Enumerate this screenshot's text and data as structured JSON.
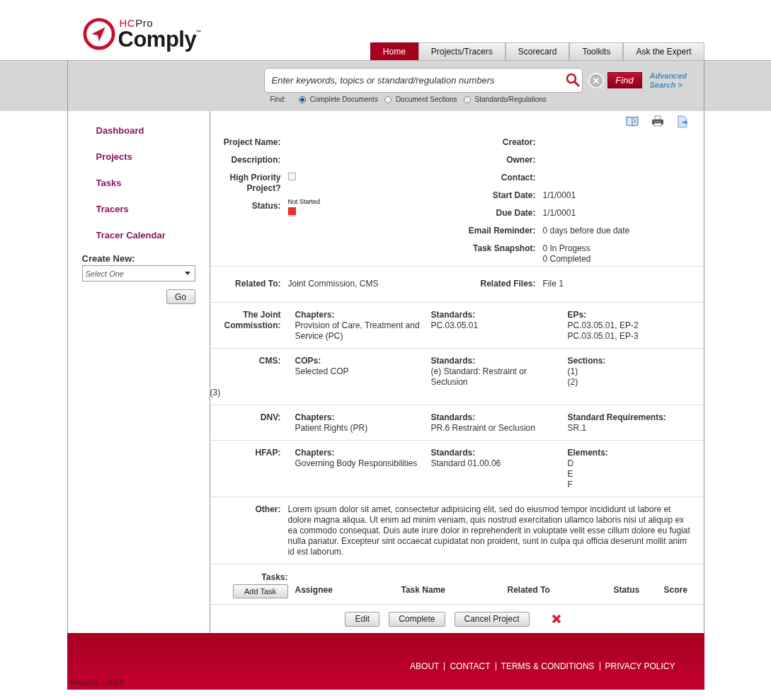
{
  "logo": {
    "prefix": "HC",
    "suffix": "Pro",
    "name": "Comply$^{™}$"
  },
  "nav_tabs": [
    {
      "label": "Home",
      "selected": true
    },
    {
      "label": "Projects/Tracers",
      "selected": false
    },
    {
      "label": "Scorecard",
      "selected": false
    },
    {
      "label": "Toolkits",
      "selected": false
    },
    {
      "label": "Ask the Expert",
      "selected": false
    }
  ],
  "search": {
    "placeholder": "Enter keywords, topics or standard/regulation numbers",
    "find_button": "Find",
    "advanced_link": "Advanced Search >",
    "find_label": "Find:",
    "options": [
      {
        "label": "Complete Documents",
        "selected": true
      },
      {
        "label": "Document Sections",
        "selected": false
      },
      {
        "label": "Standards/Regulations",
        "selected": false
      }
    ]
  },
  "sidebar": {
    "items": [
      {
        "label": "Dashboard"
      },
      {
        "label": "Projects"
      },
      {
        "label": "Tasks"
      },
      {
        "label": "Tracers"
      },
      {
        "label": "Tracer Calendar"
      }
    ],
    "create_new": "Create New:",
    "select_placeholder": "Select One",
    "go_button": "Go"
  },
  "project": {
    "left_fields": [
      {
        "kind": "text",
        "label": "Project Name:"
      },
      {
        "kind": "text",
        "label": "Description:"
      },
      {
        "kind": "checkbox",
        "label": "High Priority Project?",
        "checked": false
      },
      {
        "kind": "status",
        "label": "Status:",
        "value": "Not Started",
        "color": "#e8302a"
      }
    ],
    "right_fields": [
      {
        "label": "Creator:"
      },
      {
        "label": "Owner:"
      },
      {
        "label": "Contact:"
      },
      {
        "label": "Start Date:",
        "lines": [
          "1/1/0001"
        ]
      },
      {
        "label": "Due Date:",
        "lines": [
          "1/1/0001"
        ]
      },
      {
        "label": "Email Reminder:",
        "lines": [
          "0 days before due date"
        ]
      },
      {
        "label": "Task Snapshot:",
        "lines": [
          "0 In Progess",
          "0 Completed"
        ]
      }
    ]
  },
  "related": [
    {
      "label": "Related To:",
      "value": "Joint Commission, CMS"
    },
    {
      "label": "Related Files:",
      "value": "File 1"
    }
  ],
  "standards": [
    {
      "label": "The Joint Commisstion:",
      "columns": [
        {
          "heading": "Chapters:",
          "lines": [
            "Provision of Care, Treatment and Service (PC)"
          ]
        },
        {
          "heading": "Standards:",
          "lines": [
            "PC.03.05.01"
          ]
        },
        {
          "heading": "EPs:",
          "lines": [
            "PC.03.05.01, EP-2",
            "PC.03.05.01, EP-3"
          ]
        }
      ]
    },
    {
      "label": "CMS:",
      "columns": [
        {
          "heading": "COPs:",
          "lines": [
            "Selected COP"
          ]
        },
        {
          "heading": "Standards:",
          "lines": [
            "(e) Standard: Restraint or Seclusion"
          ]
        },
        {
          "heading": "Sections:",
          "lines": [
            "(1)",
            "(2)"
          ]
        }
      ],
      "stray_text": "(3)"
    },
    {
      "label": "DNV:",
      "columns": [
        {
          "heading": "Chapters:",
          "lines": [
            "Patient Rights (PR)"
          ]
        },
        {
          "heading": "Standards:",
          "lines": [
            "PR.6 Restraint or Seclusion"
          ]
        },
        {
          "heading": "Standard Requirements:",
          "lines": [
            "SR.1"
          ]
        }
      ]
    },
    {
      "label": "HFAP:",
      "columns": [
        {
          "heading": "Chapters:",
          "lines": [
            "Governing Body Responsibilities"
          ]
        },
        {
          "heading": "Standards:",
          "lines": [
            "Standard 01.00.06"
          ]
        },
        {
          "heading": "Elements:",
          "lines": [
            "D",
            "E",
            "F"
          ]
        }
      ]
    }
  ],
  "other": {
    "label": "Other:",
    "text": "Lorem ipsum dolor sit amet, consectetur adipisicing elit, sed do eiusmod tempor incididunt ut labore et dolore magna aliqua. Ut enim ad minim veniam, quis nostrud exercitation ullamco laboris nisi ut aliquip ex ea commodo consequat. Duis aute irure dolor in reprehenderit in voluptate velit esse cillum dolore eu fugiat nulla pariatur. Excepteur sint occaecat cupidatat non proident, sunt in culpa qui officia deserunt mollit anim id est laborum."
  },
  "tasks": {
    "label": "Tasks:",
    "add_button": "Add Task",
    "columns": [
      "Assignee",
      "Task Name",
      "Related To",
      "Status",
      "Score"
    ]
  },
  "actions": [
    "Edit",
    "Complete",
    "Cancel Project"
  ],
  "footer": {
    "links": [
      "ABOUT",
      "CONTACT",
      "TERMS & CONDITIONS",
      "PRIVACY POLICY"
    ],
    "revision": "Revision: 1.0.0.0"
  }
}
